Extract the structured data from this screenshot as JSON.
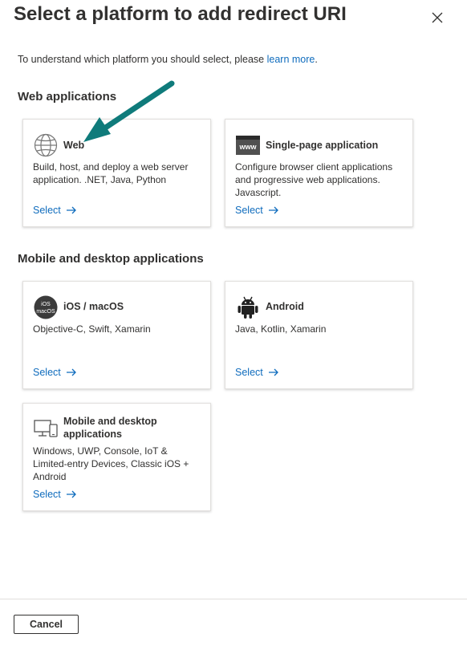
{
  "panel": {
    "title": "Select a platform to add redirect URI",
    "intro_text": "To understand which platform you should select, please ",
    "intro_link": "learn more",
    "intro_suffix": "."
  },
  "sections": {
    "web": {
      "title": "Web applications"
    },
    "mobile": {
      "title": "Mobile and desktop applications"
    }
  },
  "cards": {
    "web": {
      "name": "Web",
      "description": "Build, host, and deploy a web server application. .NET, Java, Python",
      "select_label": "Select",
      "icon": "globe-icon"
    },
    "spa": {
      "name": "Single-page application",
      "description": "Configure browser client applications and progressive web applications. Javascript.",
      "select_label": "Select",
      "icon": "www-icon",
      "icon_text": "www"
    },
    "ios": {
      "name": "iOS / macOS",
      "description": "Objective-C, Swift, Xamarin",
      "select_label": "Select",
      "icon": "ios-macos-icon",
      "icon_text_1": "iOS",
      "icon_text_2": "macOS"
    },
    "android": {
      "name": "Android",
      "description": "Java, Kotlin, Xamarin",
      "select_label": "Select",
      "icon": "android-icon"
    },
    "desktop": {
      "name": "Mobile and desktop applications",
      "description": "Windows, UWP, Console, IoT & Limited-entry Devices, Classic iOS + Android",
      "select_label": "Select",
      "icon": "desktop-mobile-icon"
    }
  },
  "footer": {
    "cancel_label": "Cancel"
  },
  "colors": {
    "link": "#0f6cbd",
    "text": "#323130",
    "annotation_arrow": "#0f7b7b",
    "card_border": "#e1dfdd"
  }
}
